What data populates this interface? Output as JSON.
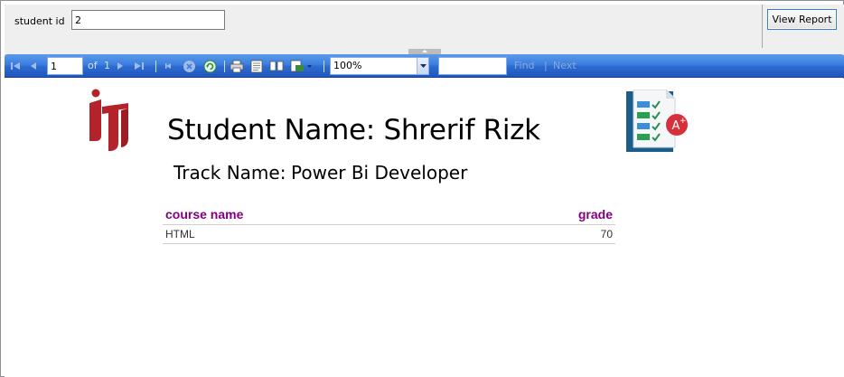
{
  "parameters": {
    "student_id_label": "student id",
    "student_id_value": "2",
    "view_report_label": "View Report"
  },
  "toolbar": {
    "page_value": "1",
    "of_label": "of",
    "total_pages": "1",
    "zoom_value": "100%",
    "find_value": "",
    "find_label": "Find",
    "find_separator": "|",
    "next_label": "Next",
    "colors": {
      "gradient_top": "#5c9ae8",
      "gradient_bottom": "#1f57bc"
    }
  },
  "report": {
    "student_name": "Student Name: Shrerif Rizk",
    "track_label": "Track Name:",
    "track_value": "Power Bi Developer",
    "logo_icon": "iti-logo",
    "grades_icon": "checklist-grade-icon",
    "table": {
      "headers": {
        "course": "course name",
        "grade": "grade"
      },
      "rows": [
        {
          "course": "HTML",
          "grade": "70"
        }
      ]
    },
    "colors": {
      "header_text": "#800080",
      "logo_red": "#b4232a"
    }
  }
}
